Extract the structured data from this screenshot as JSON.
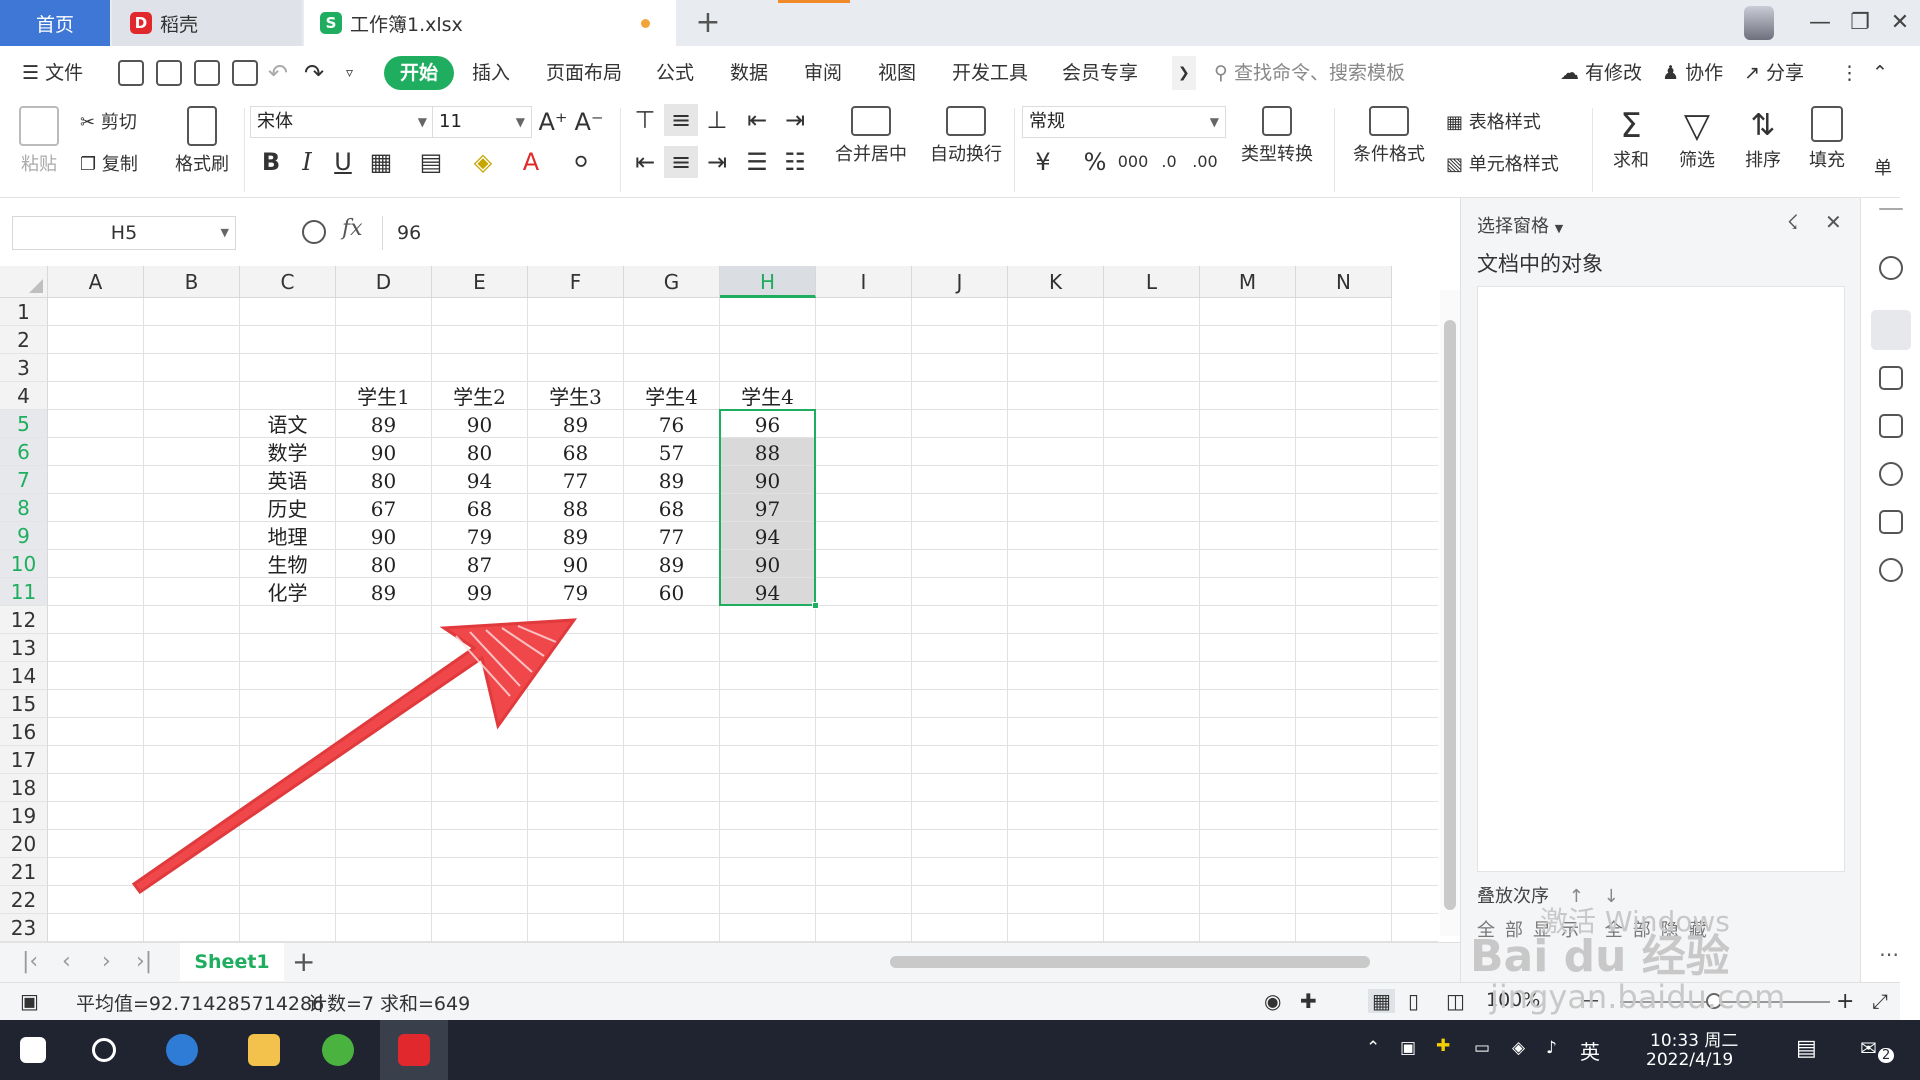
{
  "tabs": {
    "home": "首页",
    "daoke": "稻壳",
    "doc": "工作簿1.xlsx"
  },
  "menu": {
    "file": "文件",
    "items": [
      "开始",
      "插入",
      "页面布局",
      "公式",
      "数据",
      "审阅",
      "视图",
      "开发工具",
      "会员专享"
    ],
    "search_placeholder": "查找命令、搜索模板",
    "changes": "有修改",
    "collab": "协作",
    "share": "分享"
  },
  "ribbon": {
    "paste": "粘贴",
    "cut": "剪切",
    "copy": "复制",
    "format_painter": "格式刷",
    "font_name": "宋体",
    "font_size": "11",
    "number_format": "常规",
    "merge": "合并居中",
    "wrap": "自动换行",
    "type_convert": "类型转换",
    "cond_format": "条件格式",
    "table_style": "表格样式",
    "cell_style": "单元格样式",
    "sum": "求和",
    "filter": "筛选",
    "sort": "排序",
    "fill": "填充",
    "single": "单"
  },
  "formula_bar": {
    "name_box": "H5",
    "fx": "fx",
    "value": "96"
  },
  "grid": {
    "columns": [
      "A",
      "B",
      "C",
      "D",
      "E",
      "F",
      "G",
      "H",
      "I",
      "J",
      "K",
      "L",
      "M",
      "N"
    ],
    "rows": [
      "1",
      "2",
      "3",
      "4",
      "5",
      "6",
      "7",
      "8",
      "9",
      "10",
      "11",
      "12",
      "13",
      "14",
      "15",
      "16",
      "17",
      "18",
      "19",
      "20",
      "21",
      "22",
      "23"
    ],
    "headers": [
      "学生1",
      "学生2",
      "学生3",
      "学生4",
      "学生4"
    ],
    "subjects": [
      "语文",
      "数学",
      "英语",
      "历史",
      "地理",
      "生物",
      "化学"
    ],
    "scores": [
      [
        "89",
        "90",
        "89",
        "76",
        "96"
      ],
      [
        "90",
        "80",
        "68",
        "57",
        "88"
      ],
      [
        "80",
        "94",
        "77",
        "89",
        "90"
      ],
      [
        "67",
        "68",
        "88",
        "68",
        "97"
      ],
      [
        "90",
        "79",
        "89",
        "77",
        "94"
      ],
      [
        "80",
        "87",
        "90",
        "89",
        "90"
      ],
      [
        "89",
        "99",
        "79",
        "60",
        "94"
      ]
    ]
  },
  "sheet": {
    "name": "Sheet1"
  },
  "status": {
    "average": "平均值=92.714285714286",
    "count": "计数=7",
    "sum": "求和=649",
    "zoom": "100%"
  },
  "pane": {
    "title": "选择窗格",
    "subtitle": "文档中的对象",
    "order": "叠放次序",
    "buttons": "全部显示 全部隐藏"
  },
  "watermark": {
    "line1": "激活 Windows",
    "line2": "Bai du 经验",
    "line3": "jingyan.baidu.com"
  },
  "taskbar": {
    "time": "10:33 周二",
    "date": "2022/4/19",
    "ime": "英",
    "notif": "2"
  },
  "colors": {
    "accent": "#1fae5f",
    "home_tab": "#3f77d6",
    "arrow": "#f0474a"
  }
}
